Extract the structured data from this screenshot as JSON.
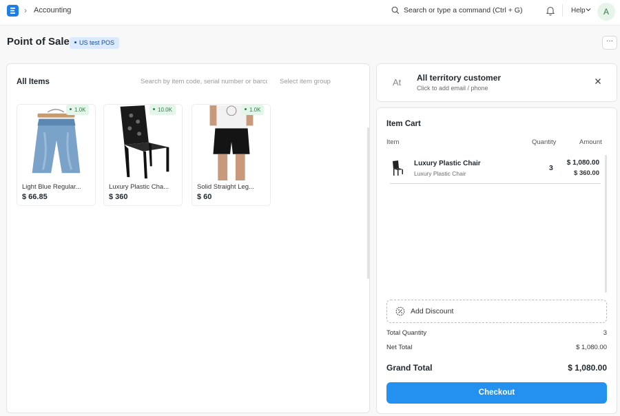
{
  "navbar": {
    "breadcrumb": "Accounting",
    "search_placeholder": "Search or type a command (Ctrl + G)",
    "help_label": "Help",
    "avatar_initial": "A"
  },
  "page": {
    "title": "Point of Sale",
    "pos_profile": "US test POS",
    "more_label": "···"
  },
  "items_panel": {
    "title": "All Items",
    "search_placeholder": "Search by item code, serial number or barcode",
    "group_placeholder": "Select item group",
    "items": [
      {
        "name": "Light Blue Regular...",
        "price": "$ 66.85",
        "stock": "1.0K",
        "icon": "denim-shorts-image"
      },
      {
        "name": "Luxury Plastic Cha...",
        "price": "$ 360",
        "stock": "10.0K",
        "icon": "black-chair-image"
      },
      {
        "name": "Solid Straight Leg...",
        "price": "$ 60",
        "stock": "1.0K",
        "icon": "black-shorts-image"
      }
    ]
  },
  "customer": {
    "avatar_text": "At",
    "name": "All territory customer",
    "subtitle": "Click to add email / phone"
  },
  "cart": {
    "title": "Item Cart",
    "columns": {
      "item": "Item",
      "quantity": "Quantity",
      "amount": "Amount"
    },
    "rows": [
      {
        "name": "Luxury Plastic Chair",
        "subtitle": "Luxury Plastic Chair",
        "quantity": "3",
        "amount": "$ 1,080.00",
        "rate": "$ 360.00"
      }
    ],
    "add_discount_label": "Add Discount",
    "total_quantity_label": "Total Quantity",
    "total_quantity_value": "3",
    "net_total_label": "Net Total",
    "net_total_value": "$ 1,080.00",
    "grand_total_label": "Grand Total",
    "grand_total_value": "$ 1,080.00",
    "checkout_label": "Checkout"
  },
  "colors": {
    "accent": "#2490ef",
    "logo": "#1f7ee3",
    "stock_badge_bg": "#e4f5e9",
    "pos_badge_bg": "#dbeafe"
  }
}
